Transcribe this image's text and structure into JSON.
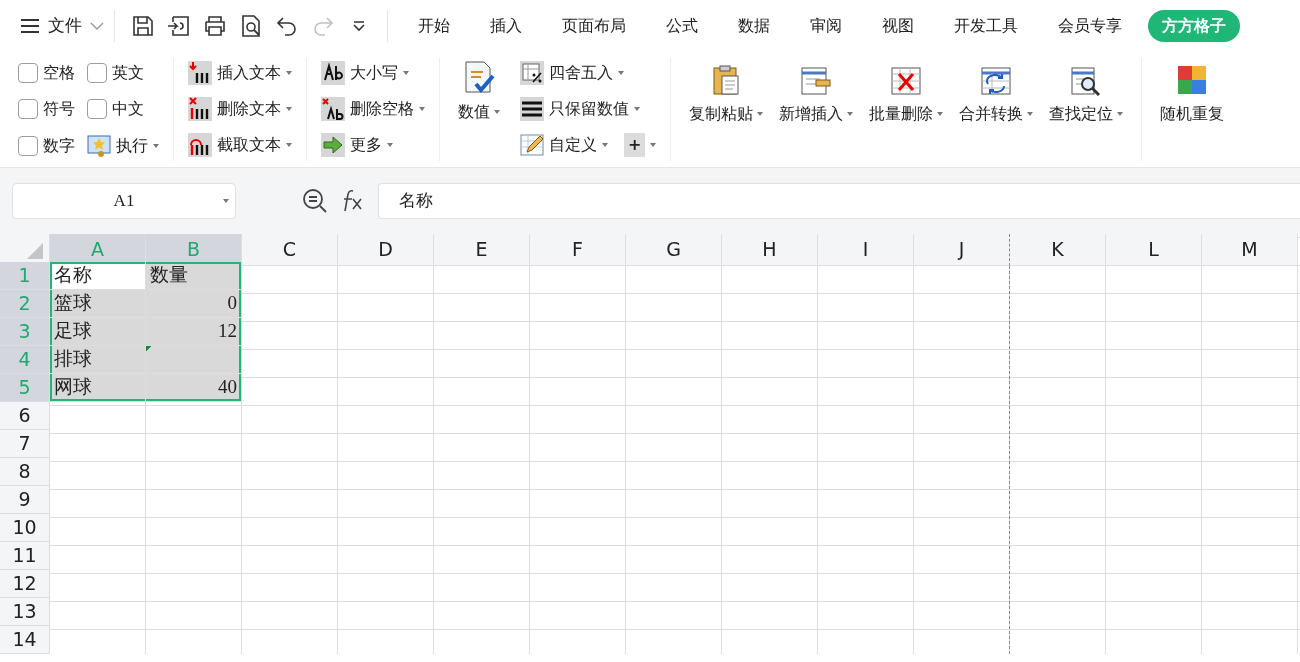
{
  "menu": {
    "label": "文件"
  },
  "quick_access": [
    {
      "disabled": false
    },
    {
      "disabled": false
    },
    {
      "disabled": false
    },
    {
      "disabled": false
    },
    {
      "disabled": false
    },
    {
      "disabled": true
    },
    {
      "disabled": false
    }
  ],
  "tabs": [
    {
      "label": "开始",
      "selected": false
    },
    {
      "label": "插入",
      "selected": false
    },
    {
      "label": "页面布局",
      "selected": false
    },
    {
      "label": "公式",
      "selected": false
    },
    {
      "label": "数据",
      "selected": false
    },
    {
      "label": "审阅",
      "selected": false
    },
    {
      "label": "视图",
      "selected": false
    },
    {
      "label": "开发工具",
      "selected": false
    },
    {
      "label": "会员专享",
      "selected": false
    },
    {
      "label": "方方格子",
      "selected": true
    }
  ],
  "ribbon": {
    "options": [
      {
        "label": "空格",
        "checked": false
      },
      {
        "label": "英文",
        "checked": false
      },
      {
        "label": "符号",
        "checked": false
      },
      {
        "label": "中文",
        "checked": false
      },
      {
        "label": "数字",
        "checked": false
      }
    ],
    "run_button": {
      "label": "执行"
    },
    "text_tools": [
      {
        "label": "插入文本"
      },
      {
        "label": "删除文本"
      },
      {
        "label": "截取文本"
      }
    ],
    "case_tools": [
      {
        "label": "大小写"
      },
      {
        "label": "删除空格"
      },
      {
        "label": "更多"
      }
    ],
    "number_button": {
      "label": "数值"
    },
    "number_tools": [
      {
        "label": "四舍五入"
      },
      {
        "label": "只保留数值"
      },
      {
        "label": "自定义"
      }
    ],
    "plus_button": {
      "label": "+"
    },
    "large_tools": [
      {
        "label": "复制粘贴"
      },
      {
        "label": "新增插入"
      },
      {
        "label": "批量删除"
      },
      {
        "label": "合并转换"
      },
      {
        "label": "查找定位"
      },
      {
        "label": "随机重复"
      }
    ]
  },
  "formula_bar": {
    "name_box": "A1",
    "formula": "名称"
  },
  "sheet": {
    "columns": [
      {
        "label": "A",
        "selected": true
      },
      {
        "label": "B",
        "selected": true
      },
      {
        "label": "C",
        "selected": false
      },
      {
        "label": "D",
        "selected": false
      },
      {
        "label": "E",
        "selected": false
      },
      {
        "label": "F",
        "selected": false
      },
      {
        "label": "G",
        "selected": false
      },
      {
        "label": "H",
        "selected": false
      },
      {
        "label": "I",
        "selected": false
      },
      {
        "label": "J",
        "selected": false
      },
      {
        "label": "K",
        "selected": false
      },
      {
        "label": "L",
        "selected": false
      },
      {
        "label": "M",
        "selected": false
      }
    ],
    "rows": [
      {
        "label": "1",
        "selected": true,
        "cells": [
          {
            "text": "名称",
            "kind": "text",
            "selected": true,
            "active": true
          },
          {
            "text": "数量",
            "kind": "text",
            "selected": true,
            "active": false
          }
        ]
      },
      {
        "label": "2",
        "selected": true,
        "cells": [
          {
            "text": "篮球",
            "kind": "text",
            "selected": true,
            "active": false
          },
          {
            "text": "0",
            "kind": "number",
            "selected": true,
            "active": false
          }
        ]
      },
      {
        "label": "3",
        "selected": true,
        "cells": [
          {
            "text": "足球",
            "kind": "text",
            "selected": true,
            "active": false
          },
          {
            "text": "12",
            "kind": "number",
            "selected": true,
            "active": false
          }
        ]
      },
      {
        "label": "4",
        "selected": true,
        "cells": [
          {
            "text": "排球",
            "kind": "text",
            "selected": true,
            "active": false
          },
          {
            "kind": "number",
            "selected": true,
            "active": false,
            "flagged": true
          }
        ]
      },
      {
        "label": "5",
        "selected": true,
        "cells": [
          {
            "text": "网球",
            "kind": "text",
            "selected": true,
            "active": false
          },
          {
            "text": "40",
            "kind": "number",
            "selected": true,
            "active": false
          }
        ]
      },
      {
        "label": "6",
        "selected": false
      },
      {
        "label": "7",
        "selected": false
      },
      {
        "label": "8",
        "selected": false
      },
      {
        "label": "9",
        "selected": false
      },
      {
        "label": "10",
        "selected": false
      },
      {
        "label": "11",
        "selected": false
      },
      {
        "label": "12",
        "selected": false
      },
      {
        "label": "13",
        "selected": false
      },
      {
        "label": "14",
        "selected": false
      }
    ]
  }
}
